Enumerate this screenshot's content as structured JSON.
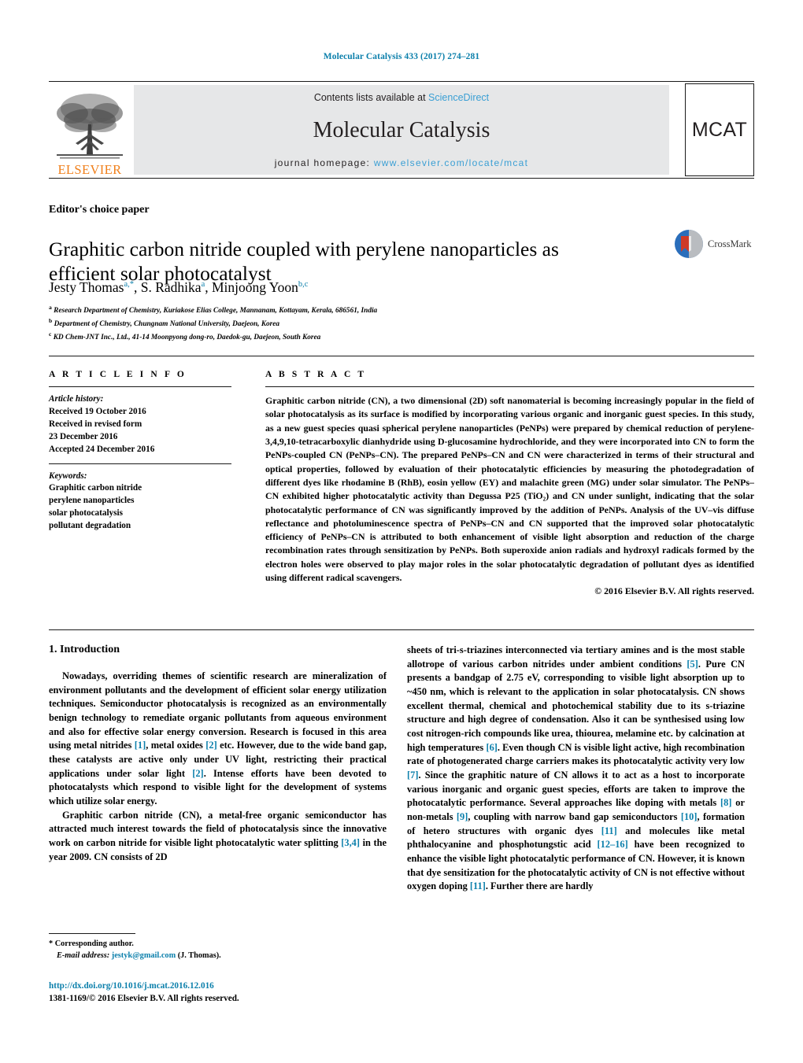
{
  "running_head": "Molecular Catalysis 433 (2017) 274–281",
  "masthead": {
    "publisher_name": "ELSEVIER",
    "contents_prefix": "Contents lists available at ",
    "contents_link": "ScienceDirect",
    "journal_name": "Molecular Catalysis",
    "homepage_prefix": "journal homepage: ",
    "homepage_link": "www.elsevier.com/locate/mcat",
    "cover_abbrev": "MCAT"
  },
  "article": {
    "type_label": "Editor's choice paper",
    "title": "Graphitic carbon nitride coupled with perylene nanoparticles as efficient solar photocatalyst",
    "crossmark_label": "CrossMark",
    "authors": [
      {
        "name": "Jesty Thomas",
        "marks": "a,*"
      },
      {
        "name": "S. Radhika",
        "marks": "a"
      },
      {
        "name": "Minjoong Yoon",
        "marks": "b,c"
      }
    ],
    "affiliations": [
      {
        "mark": "a",
        "text": "Research Department of Chemistry, Kuriakose Elias College, Mannanam, Kottayam, Kerala, 686561, India"
      },
      {
        "mark": "b",
        "text": "Department of Chemistry, Chungnam National University, Daejeon, Korea"
      },
      {
        "mark": "c",
        "text": "KD Chem-JNT Inc., Ltd., 41-14 Moonpyong dong-ro, Daedok-gu, Daejeon, South Korea"
      }
    ]
  },
  "article_info": {
    "heading": "A R T I C L E    I N F O",
    "history_label": "Article history:",
    "history": [
      "Received 19 October 2016",
      "Received in revised form",
      "23 December 2016",
      "Accepted 24 December 2016"
    ],
    "keywords_label": "Keywords:",
    "keywords": [
      "Graphitic carbon nitride",
      "perylene nanoparticles",
      "solar photocatalysis",
      "pollutant degradation"
    ]
  },
  "abstract": {
    "heading": "A B S T R A C T",
    "text": "Graphitic carbon nitride (CN), a two dimensional (2D) soft nanomaterial is becoming increasingly popular in the field of solar photocatalysis as its surface is modified by incorporating various organic and inorganic guest species. In this study, as a new guest species quasi spherical perylene nanoparticles (PeNPs) were prepared by chemical reduction of perylene-3,4,9,10-tetracarboxylic dianhydride using D-glucosamine hydrochloride, and they were incorporated into CN to form the PeNPs-coupled CN (PeNPs–CN). The prepared PeNPs–CN and CN were characterized in terms of their structural and optical properties, followed by evaluation of their photocatalytic efficiencies by measuring the photodegradation of different dyes like rhodamine B (RhB), eosin yellow (EY) and malachite green (MG) under solar simulator. The PeNPs–CN exhibited higher photocatalytic activity than Degussa P25 (TiO₂) and CN under sunlight, indicating that the solar photocatalytic performance of CN was significantly improved by the addition of PeNPs. Analysis of the UV–vis diffuse reflectance and photoluminescence spectra of PeNPs–CN and CN supported that the improved solar photocatalytic efficiency of PeNPs–CN is attributed to both enhancement of visible light absorption and reduction of the charge recombination rates through sensitization by PeNPs. Both superoxide anion radials and hydroxyl radicals formed by the electron holes were observed to play major roles in the solar photocatalytic degradation of pollutant dyes as identified using different radical scavengers.",
    "copyright": "© 2016 Elsevier B.V. All rights reserved."
  },
  "introduction": {
    "heading": "1.  Introduction",
    "left_paragraph_1": "Nowadays, overriding themes of scientific research are mineralization of environment pollutants and the development of efficient solar energy utilization techniques. Semiconductor photocatalysis is recognized as an environmentally benign technology to remediate organic pollutants from aqueous environment and also for effective solar energy conversion. Research is focused in this area using metal nitrides [1], metal oxides [2] etc. However, due to the wide band gap, these catalysts are active only under UV light, restricting their practical applications under solar light [2]. Intense efforts have been devoted to photocatalysts which respond to visible light for the development of systems which utilize solar energy.",
    "left_paragraph_2": "Graphitic carbon nitride (CN), a metal-free organic semiconductor has attracted much interest towards the field of photocatalysis since the innovative work on carbon nitride for visible light photocatalytic water splitting [3,4] in the year 2009. CN consists of 2D",
    "right_paragraph_1": "sheets of tri-s-triazines interconnected via tertiary amines and is the most stable allotrope of various carbon nitrides under ambient conditions [5]. Pure CN presents a bandgap of 2.75 eV, corresponding to visible light absorption up to ~450 nm, which is relevant to the application in solar photocatalysis. CN shows excellent thermal, chemical and photochemical stability due to its s-triazine structure and high degree of condensation. Also it can be synthesised using low cost nitrogen-rich compounds like urea, thiourea, melamine etc. by calcination at high temperatures [6]. Even though CN is visible light active, high recombination rate of photogenerated charge carriers makes its photocatalytic activity very low [7]. Since the graphitic nature of CN allows it to act as a host to incorporate various inorganic and organic guest species, efforts are taken to improve the photocatalytic performance. Several approaches like doping with metals [8] or non-metals [9], coupling with narrow band gap semiconductors [10], formation of hetero structures with organic dyes [11] and molecules like metal phthalocyanine and phosphotungstic acid [12–16] have been recognized to enhance the visible light photocatalytic performance of CN. However, it is known that dye sensitization for the photocatalytic activity of CN is not effective without oxygen doping [11]. Further there are hardly"
  },
  "footnote": {
    "corresponding_label": "*  Corresponding author.",
    "email_label": "E-mail address:",
    "email": "jestyk@gmail.com",
    "email_suffix": "(J. Thomas)."
  },
  "footer": {
    "doi": "http://dx.doi.org/10.1016/j.mcat.2016.12.016",
    "issn_line": "1381-1169/© 2016 Elsevier B.V. All rights reserved."
  },
  "colors": {
    "teal_link": "#0b7fab",
    "light_blue_link": "#3a9fd4",
    "elsevier_orange": "#f07f1a",
    "banner_gray": "#e6e7e8"
  }
}
